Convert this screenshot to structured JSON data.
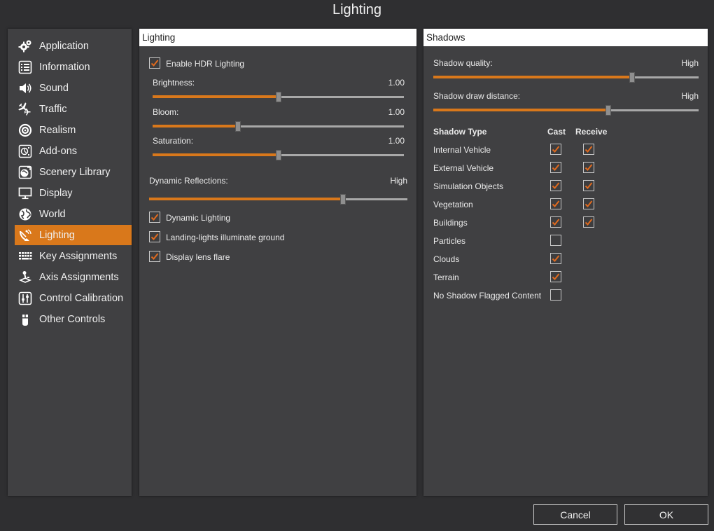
{
  "window": {
    "title": "Lighting"
  },
  "sidebar": {
    "items": [
      {
        "label": "Application",
        "icon": "gears-icon"
      },
      {
        "label": "Information",
        "icon": "list-icon"
      },
      {
        "label": "Sound",
        "icon": "speaker-icon"
      },
      {
        "label": "Traffic",
        "icon": "planes-icon"
      },
      {
        "label": "Realism",
        "icon": "target-icon"
      },
      {
        "label": "Add-ons",
        "icon": "addons-icon"
      },
      {
        "label": "Scenery Library",
        "icon": "scenery-icon"
      },
      {
        "label": "Display",
        "icon": "monitor-icon"
      },
      {
        "label": "World",
        "icon": "globe-icon"
      },
      {
        "label": "Lighting",
        "icon": "satellite-dish-icon"
      },
      {
        "label": "Key Assignments",
        "icon": "keyboard-icon"
      },
      {
        "label": "Axis Assignments",
        "icon": "joystick-icon"
      },
      {
        "label": "Control Calibration",
        "icon": "calibration-icon"
      },
      {
        "label": "Other Controls",
        "icon": "controller-icon"
      }
    ],
    "active_index": 9
  },
  "lighting": {
    "header": "Lighting",
    "hdr": {
      "label": "Enable HDR Lighting",
      "checked": true
    },
    "sliders": [
      {
        "label": "Brightness:",
        "value": "1.00",
        "fraction": 0.5
      },
      {
        "label": "Bloom:",
        "value": "1.00",
        "fraction": 0.34
      },
      {
        "label": "Saturation:",
        "value": "1.00",
        "fraction": 0.5
      }
    ],
    "reflections": {
      "label": "Dynamic Reflections:",
      "value": "High",
      "fraction": 0.75
    },
    "options": [
      {
        "label": "Dynamic Lighting",
        "checked": true
      },
      {
        "label": "Landing-lights illuminate ground",
        "checked": true
      },
      {
        "label": "Display lens flare",
        "checked": true
      }
    ]
  },
  "shadows": {
    "header": "Shadows",
    "quality": {
      "label": "Shadow quality:",
      "value": "High",
      "fraction": 0.75
    },
    "distance": {
      "label": "Shadow draw distance:",
      "value": "High",
      "fraction": 0.66
    },
    "table": {
      "col_type": "Shadow Type",
      "col_cast": "Cast",
      "col_receive": "Receive",
      "rows": [
        {
          "label": "Internal Vehicle",
          "cast": true,
          "receive": true
        },
        {
          "label": "External Vehicle",
          "cast": true,
          "receive": true
        },
        {
          "label": "Simulation Objects",
          "cast": true,
          "receive": true
        },
        {
          "label": "Vegetation",
          "cast": true,
          "receive": true
        },
        {
          "label": "Buildings",
          "cast": true,
          "receive": true
        },
        {
          "label": "Particles",
          "cast": false,
          "receive": null
        },
        {
          "label": "Clouds",
          "cast": true,
          "receive": null
        },
        {
          "label": "Terrain",
          "cast": true,
          "receive": null
        },
        {
          "label": "No Shadow Flagged Content",
          "cast": false,
          "receive": null
        }
      ]
    }
  },
  "buttons": {
    "cancel": "Cancel",
    "ok": "OK"
  },
  "colors": {
    "accent": "#d9781b",
    "panel": "#404042",
    "background": "#2f2f31",
    "check": "#e06a1e"
  }
}
